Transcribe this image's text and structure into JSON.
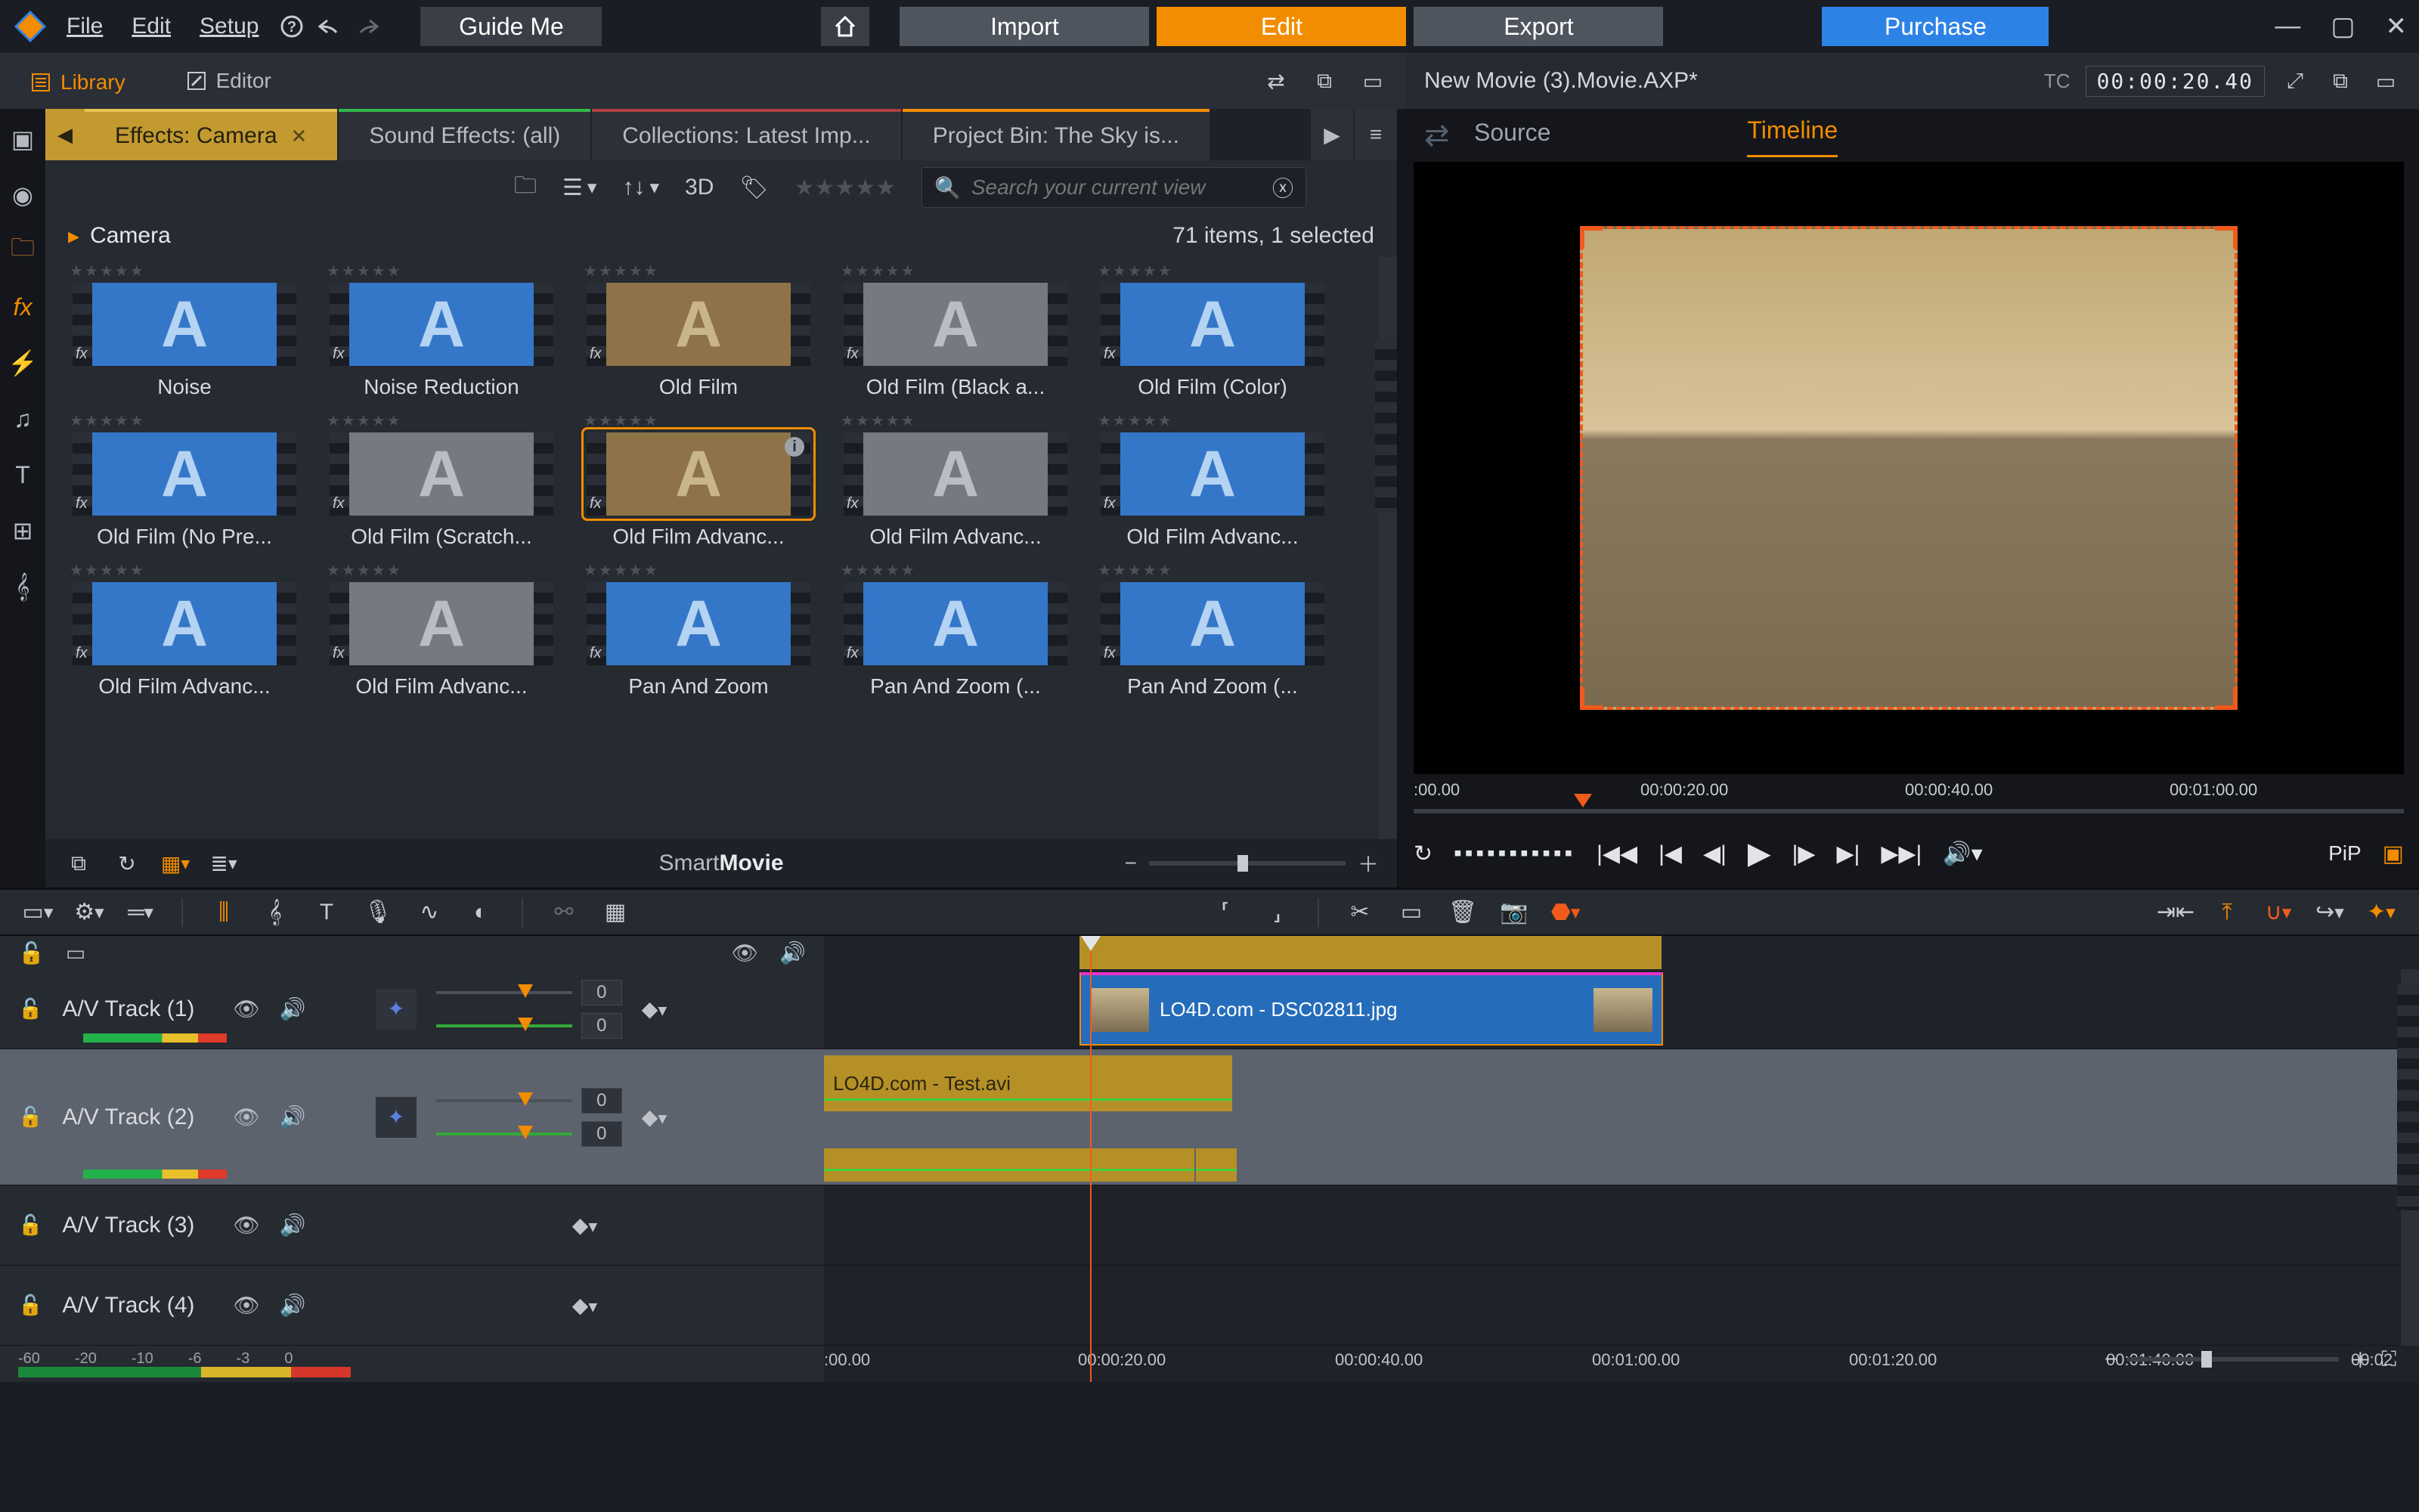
{
  "menu": {
    "file": "File",
    "edit": "Edit",
    "setup": "Setup"
  },
  "toolbar": {
    "guide": "Guide Me",
    "import": "Import",
    "editBtn": "Edit",
    "export": "Export",
    "purchase": "Purchase"
  },
  "sec": {
    "library": "Library",
    "editor": "Editor"
  },
  "movie": {
    "name": "New Movie (3).Movie.AXP*",
    "tcLabel": "TC",
    "tc": "00:00:20.40"
  },
  "tabs": {
    "effects": "Effects: Camera",
    "sound": "Sound Effects: (all)",
    "collections": "Collections: Latest Imp...",
    "bin": "Project Bin: The Sky is..."
  },
  "libToolbar": {
    "threeD": "3D"
  },
  "search": {
    "placeholder": "Search your current view"
  },
  "libHeader": {
    "title": "Camera",
    "count": "71 items, 1 selected"
  },
  "effects": [
    {
      "label": "Noise",
      "style": "blue"
    },
    {
      "label": "Noise Reduction",
      "style": "blue"
    },
    {
      "label": "Old Film",
      "style": "brown"
    },
    {
      "label": "Old Film (Black a...",
      "style": "gray"
    },
    {
      "label": "Old Film (Color)",
      "style": "blue"
    },
    {
      "label": "Old Film (No Pre...",
      "style": "blue"
    },
    {
      "label": "Old Film (Scratch...",
      "style": "gray"
    },
    {
      "label": "Old Film Advanc...",
      "style": "brown",
      "selected": true
    },
    {
      "label": "Old Film Advanc...",
      "style": "gray"
    },
    {
      "label": "Old Film Advanc...",
      "style": "blue"
    },
    {
      "label": "Old Film Advanc...",
      "style": "blue"
    },
    {
      "label": "Old Film Advanc...",
      "style": "gray"
    },
    {
      "label": "Pan And Zoom",
      "style": "blue"
    },
    {
      "label": "Pan And Zoom (...",
      "style": "blue"
    },
    {
      "label": "Pan And Zoom (...",
      "style": "blue"
    }
  ],
  "smartmovie": {
    "a": "Smart",
    "b": "Movie"
  },
  "preview": {
    "source": "Source",
    "timeline": "Timeline",
    "pip": "PiP",
    "ticks": [
      ":00.00",
      "00:00:20.00",
      "00:00:40.00",
      "00:01:00.00"
    ]
  },
  "tracks": {
    "t1": {
      "name": "A/V Track (1)",
      "v1": "0",
      "v2": "0"
    },
    "t2": {
      "name": "A/V Track (2)",
      "v1": "0",
      "v2": "0"
    },
    "t3": {
      "name": "A/V Track (3)"
    },
    "t4": {
      "name": "A/V Track (4)"
    },
    "clip1": "LO4D.com - DSC02811.jpg",
    "clip2": "LO4D.com - Test.avi"
  },
  "audioScale": [
    "-60",
    "-20",
    "-10",
    "-6",
    "-3",
    "0"
  ],
  "tlRuler": [
    ":00.00",
    "00:00:20.00",
    "00:00:40.00",
    "00:01:00.00",
    "00:01:20.00",
    "00:01:40.00",
    "00:02"
  ]
}
